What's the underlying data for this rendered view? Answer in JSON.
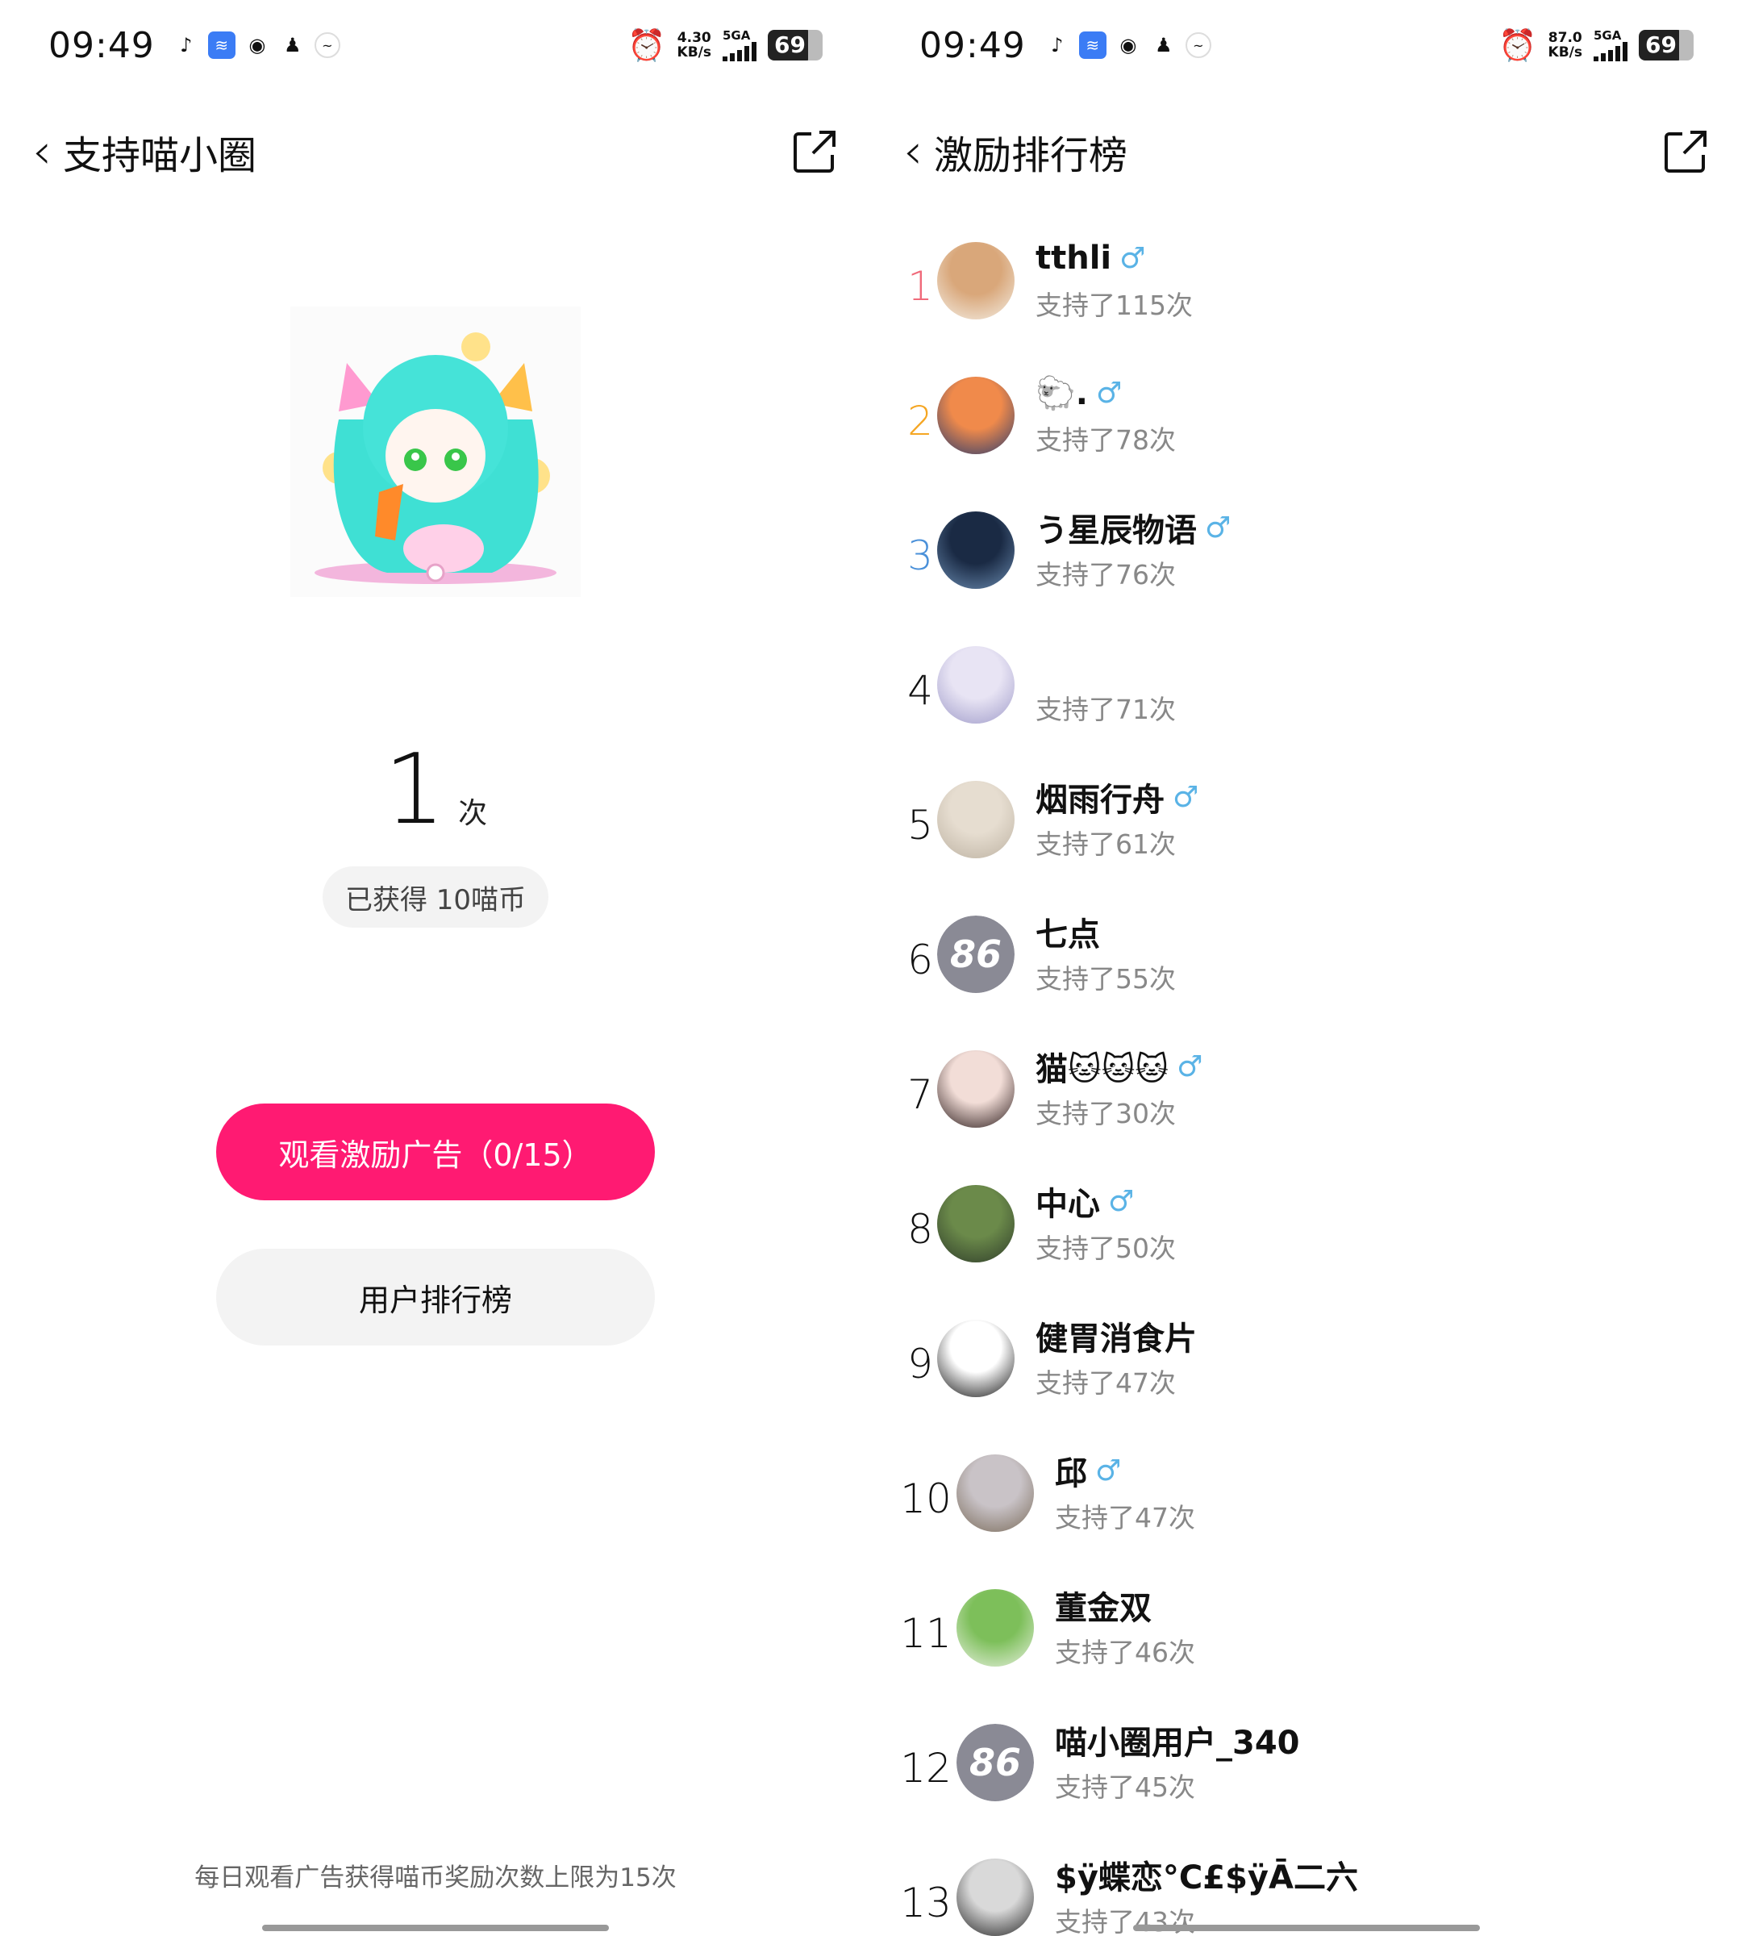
{
  "status_left": {
    "time": "09:49",
    "icons": [
      "tiktok-icon",
      "wifi-assist-icon",
      "wechat-icon",
      "qq-icon",
      "misc-icon"
    ],
    "speed": "4.30\nKB/s",
    "net": "5GA",
    "battery": "69"
  },
  "status_right": {
    "time": "09:49",
    "icons": [
      "tiktok-icon",
      "wifi-assist-icon",
      "wechat-icon",
      "qq-icon",
      "misc-icon"
    ],
    "speed": "87.0\nKB/s",
    "net": "5GA",
    "battery": "69"
  },
  "left": {
    "title": "支持喵小圈",
    "count": "1",
    "count_unit": "次",
    "earned": "已获得 10喵币",
    "watch_button": "观看激励广告（0/15）",
    "rank_button": "用户排行榜",
    "note": "每日观看广告获得喵币奖励次数上限为15次"
  },
  "right": {
    "title": "激励排行榜",
    "male_symbol": "♂",
    "rows": [
      {
        "rank": "1",
        "name": "tthli",
        "male": true,
        "support": "支持了115次",
        "avatar": "cat-sunglasses",
        "colors": [
          "#d9a77a",
          "#f4efe6"
        ]
      },
      {
        "rank": "2",
        "name": "🐑.",
        "male": true,
        "support": "支持了78次",
        "avatar": "anime-boy-sunset",
        "colors": [
          "#f08a4b",
          "#2a3b6e"
        ]
      },
      {
        "rank": "3",
        "name": "う星辰物语",
        "male": true,
        "support": "支持了76次",
        "avatar": "night-sky",
        "colors": [
          "#1a2a44",
          "#6a8bb0"
        ]
      },
      {
        "rank": "4",
        "name": "",
        "male": false,
        "support": "支持了71次",
        "avatar": "anime-girl-white-hair",
        "colors": [
          "#e8e4f4",
          "#9f9bc9"
        ]
      },
      {
        "rank": "5",
        "name": "烟雨行舟",
        "male": true,
        "support": "支持了61次",
        "avatar": "sketch-boy",
        "colors": [
          "#e6ddd0",
          "#bdb2a2"
        ]
      },
      {
        "rank": "6",
        "name": "七点",
        "male": false,
        "support": "支持了55次",
        "avatar": "default-86",
        "badge": "86"
      },
      {
        "rank": "7",
        "name": "猫🐱🐱🐱",
        "male": true,
        "support": "支持了30次",
        "avatar": "girl-portrait",
        "colors": [
          "#f2ddd7",
          "#2a1a1a"
        ]
      },
      {
        "rank": "8",
        "name": "中心",
        "male": true,
        "support": "支持了50次",
        "avatar": "outdoor-photo",
        "colors": [
          "#6b8a4a",
          "#2e3b2a"
        ]
      },
      {
        "rank": "9",
        "name": "健胃消食片",
        "male": false,
        "support": "支持了47次",
        "avatar": "black-cat-sticker",
        "colors": [
          "#ffffff",
          "#111111"
        ]
      },
      {
        "rank": "10",
        "name": "邱",
        "male": true,
        "support": "支持了47次",
        "avatar": "anime-silver-hair",
        "colors": [
          "#c9c3c7",
          "#7a6b5a"
        ]
      },
      {
        "rank": "11",
        "name": "董金双",
        "male": false,
        "support": "支持了46次",
        "avatar": "frog-keep-cool",
        "colors": [
          "#7dbf5a",
          "#e8f0e0"
        ]
      },
      {
        "rank": "12",
        "name": "喵小圈用户_340",
        "male": false,
        "support": "支持了45次",
        "avatar": "default-86",
        "badge": "86"
      },
      {
        "rank": "13",
        "name": "$ÿ蝶恋°C£$ÿĀ二六",
        "male": false,
        "support": "支持了43次",
        "avatar": "bw-portrait",
        "colors": [
          "#d9d9d9",
          "#222222"
        ]
      }
    ]
  },
  "colors": {
    "accent": "#ff1a72",
    "male": "#5ab3e6",
    "rank1": "#f06a7a",
    "rank2": "#f5a623",
    "rank3": "#4a90d9"
  }
}
